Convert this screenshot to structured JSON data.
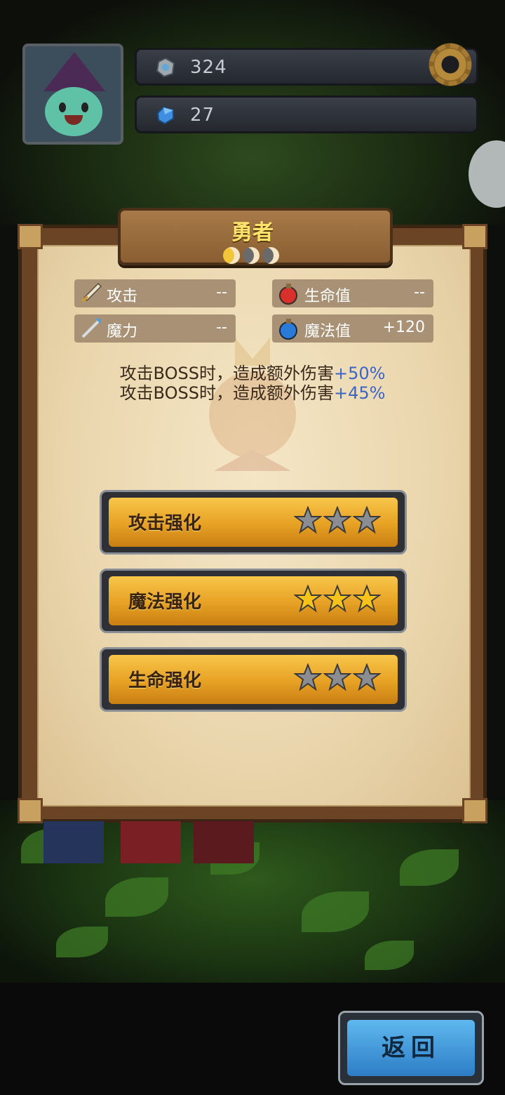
{
  "resources": {
    "stone": {
      "value": "324",
      "icon": "stone-icon"
    },
    "gem": {
      "value": "27",
      "icon": "blue-gem-icon"
    }
  },
  "panel": {
    "title": "勇者",
    "rank_moons": 3,
    "stats": {
      "attack": {
        "label": "攻击",
        "value": "--",
        "icon": "sword-icon"
      },
      "hp": {
        "label": "生命值",
        "value": "--",
        "icon": "red-potion-icon"
      },
      "magic_power": {
        "label": "魔力",
        "value": "--",
        "icon": "staff-icon"
      },
      "mp": {
        "label": "魔法值",
        "value": "+120",
        "icon": "blue-potion-icon"
      }
    },
    "effects": [
      {
        "text": "攻击BOSS时，造成额外伤害",
        "value": "+50%"
      },
      {
        "text": "攻击BOSS时，造成额外伤害",
        "value": "+45%"
      }
    ],
    "upgrades": [
      {
        "label": "攻击强化",
        "stars_filled": 0,
        "stars_total": 3
      },
      {
        "label": "魔法强化",
        "stars_filled": 3,
        "stars_total": 3
      },
      {
        "label": "生命强化",
        "stars_filled": 0,
        "stars_total": 3
      }
    ]
  },
  "back_button": {
    "label": "返回"
  },
  "colors": {
    "accent_gold": "#f0b33a",
    "highlight_blue": "#3c64c8",
    "back_blue": "#3d94dc"
  }
}
